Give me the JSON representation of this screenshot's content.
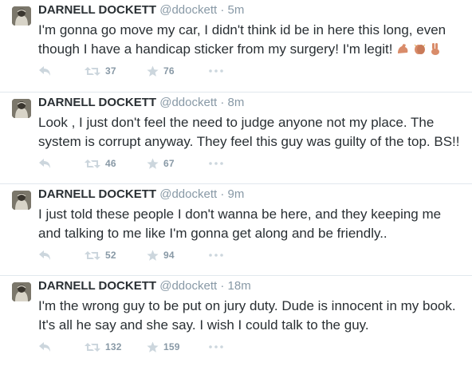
{
  "tweets": [
    {
      "name": "DARNELL DOCKETT",
      "handle": "@ddockett",
      "separator": "·",
      "time": "5m",
      "text": "I'm gonna go move my car, I didn't think id be in here this long, even though I have a handicap sticker from my surgery! I'm legit!",
      "emojis": [
        "flexed-biceps-icon",
        "clapping-hands-icon",
        "victory-hand-icon"
      ],
      "retweets": "37",
      "favorites": "76"
    },
    {
      "name": "DARNELL DOCKETT",
      "handle": "@ddockett",
      "separator": "·",
      "time": "8m",
      "text": "Look , I just don't feel the need to judge anyone not my place. The system is corrupt anyway. They feel this guy was guilty of the top. BS!!",
      "retweets": "46",
      "favorites": "67"
    },
    {
      "name": "DARNELL DOCKETT",
      "handle": "@ddockett",
      "separator": "·",
      "time": "9m",
      "text": "I just told these people I don't wanna be here, and they keeping me and talking to me like I'm gonna get along and be friendly..",
      "retweets": "52",
      "favorites": "94"
    },
    {
      "name": "DARNELL DOCKETT",
      "handle": "@ddockett",
      "separator": "·",
      "time": "18m",
      "text": "I'm the wrong guy to be put on jury duty. Dude is innocent in my book. It's all he say and she say. I wish I could talk to the guy.",
      "retweets": "132",
      "favorites": "159"
    }
  ],
  "colors": {
    "text": "#292f33",
    "muted": "#8899a6",
    "icon": "#ccd6dd",
    "divider": "#e1e8ed"
  }
}
